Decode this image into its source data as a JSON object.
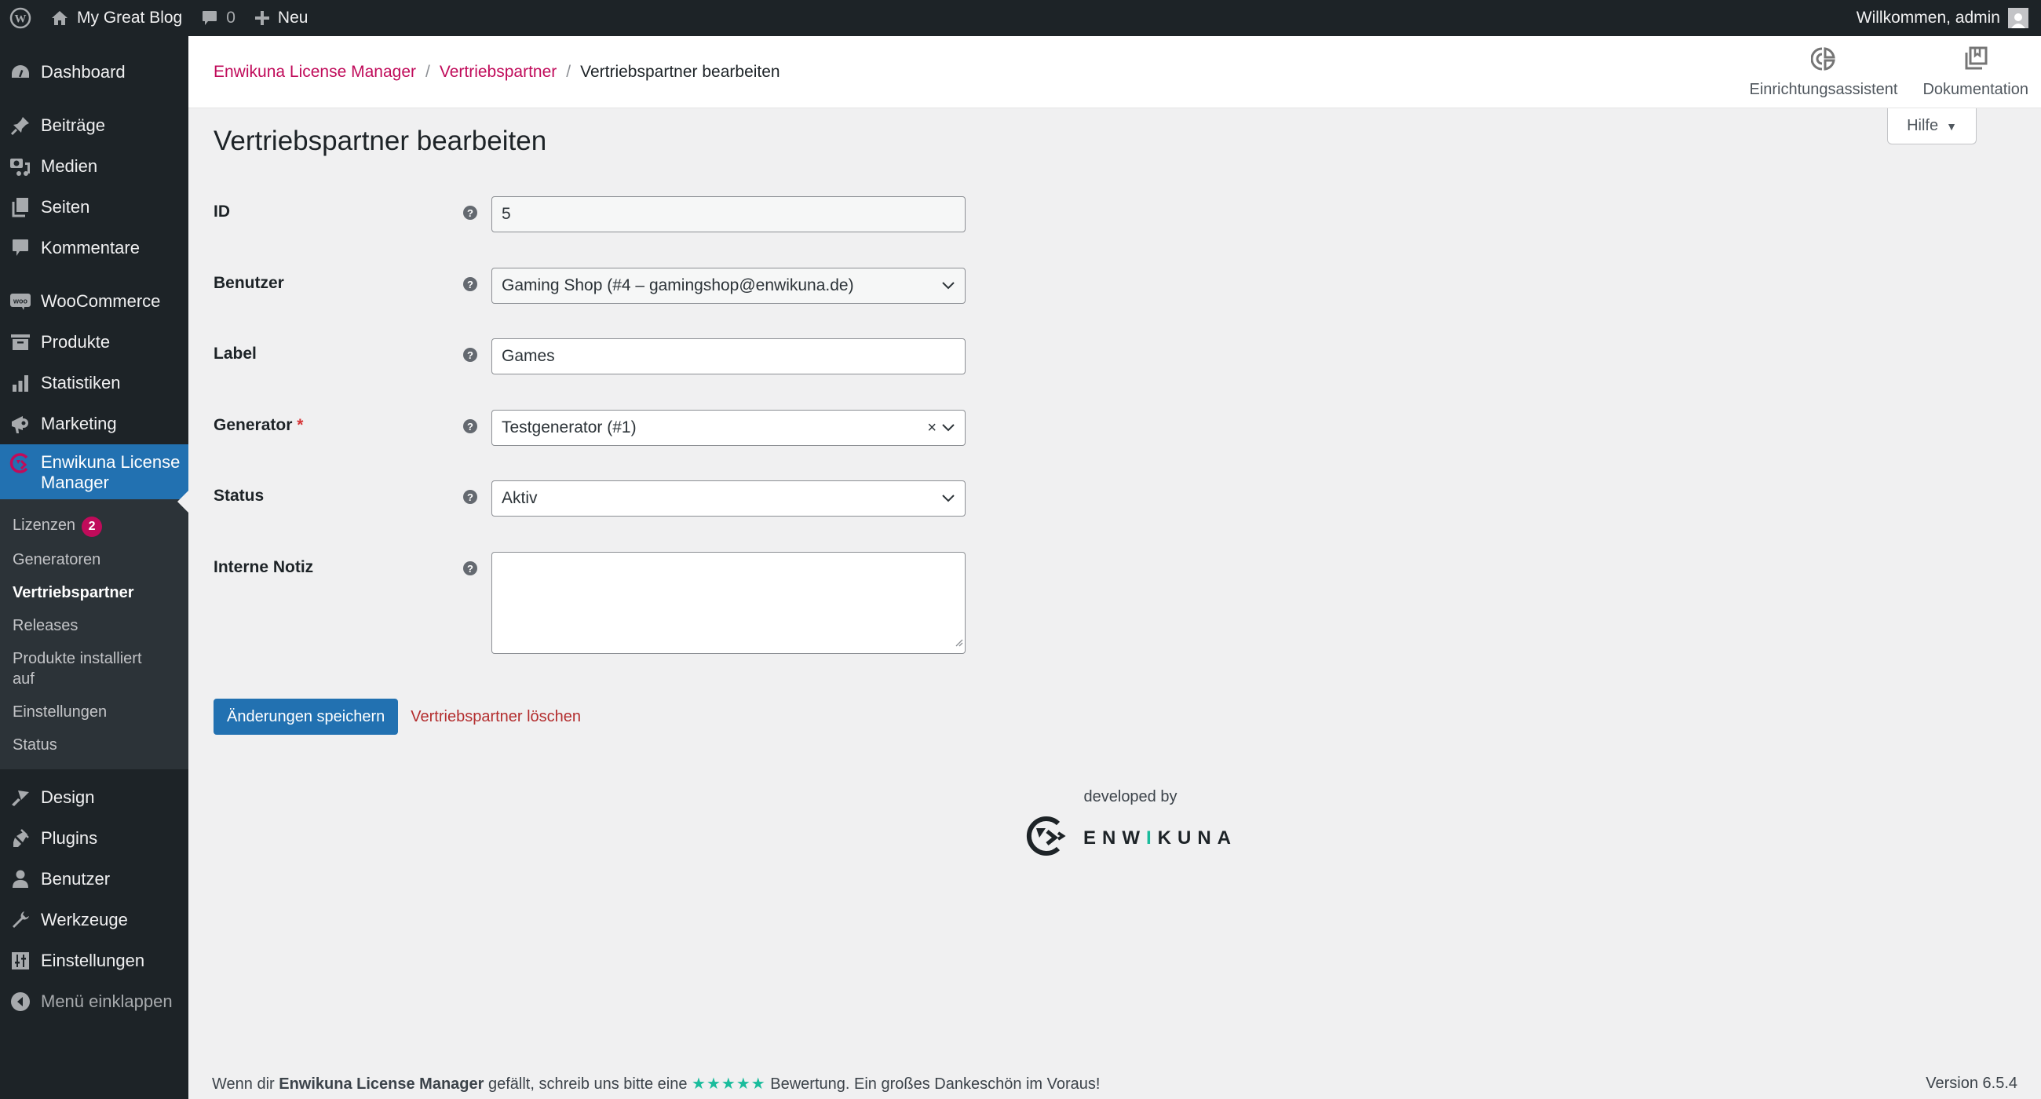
{
  "adminbar": {
    "site_name": "My Great Blog",
    "comments_count": "0",
    "new_label": "Neu",
    "greeting": "Willkommen, admin"
  },
  "sidebar": {
    "items": [
      {
        "label": "Dashboard",
        "icon": "dashboard-icon"
      },
      {
        "label": "Beiträge",
        "icon": "pin-icon"
      },
      {
        "label": "Medien",
        "icon": "media-icon"
      },
      {
        "label": "Seiten",
        "icon": "pages-icon"
      },
      {
        "label": "Kommentare",
        "icon": "comment-icon"
      },
      {
        "label": "WooCommerce",
        "icon": "woo-icon"
      },
      {
        "label": "Produkte",
        "icon": "archive-icon"
      },
      {
        "label": "Statistiken",
        "icon": "bar-chart-icon"
      },
      {
        "label": "Marketing",
        "icon": "megaphone-icon"
      },
      {
        "label": "Enwikuna License Manager",
        "icon": "enwikuna-icon"
      },
      {
        "label": "Design",
        "icon": "brush-icon"
      },
      {
        "label": "Plugins",
        "icon": "plug-icon"
      },
      {
        "label": "Benutzer",
        "icon": "user-icon"
      },
      {
        "label": "Werkzeuge",
        "icon": "wrench-icon"
      },
      {
        "label": "Einstellungen",
        "icon": "settings-icon"
      }
    ],
    "submenu": [
      {
        "label": "Lizenzen",
        "badge": "2"
      },
      {
        "label": "Generatoren"
      },
      {
        "label": "Vertriebspartner",
        "active": true
      },
      {
        "label": "Releases"
      },
      {
        "label": "Produkte installiert auf"
      },
      {
        "label": "Einstellungen"
      },
      {
        "label": "Status"
      }
    ],
    "collapse_label": "Menü einklappen"
  },
  "header": {
    "breadcrumb": [
      "Enwikuna License Manager",
      "Vertriebspartner",
      "Vertriebspartner bearbeiten"
    ],
    "actions": [
      {
        "label": "Einrichtungsassistent",
        "icon": "setup-wizard-icon"
      },
      {
        "label": "Dokumentation",
        "icon": "documentation-icon"
      }
    ],
    "help_label": "Hilfe"
  },
  "page": {
    "title": "Vertriebspartner bearbeiten",
    "fields": {
      "id": {
        "label": "ID",
        "value": "5"
      },
      "user": {
        "label": "Benutzer",
        "value": "Gaming Shop (#4 – gamingshop@enwikuna.de)"
      },
      "label": {
        "label": "Label",
        "value": "Games"
      },
      "generator": {
        "label": "Generator",
        "required_mark": "*",
        "value": "Testgenerator (#1)"
      },
      "status": {
        "label": "Status",
        "value": "Aktiv"
      },
      "note": {
        "label": "Interne Notiz",
        "value": ""
      }
    },
    "save_label": "Änderungen speichern",
    "delete_label": "Vertriebspartner löschen",
    "developed_by": "developed by",
    "logo_text_a": "ENW",
    "logo_text_b": "I",
    "logo_text_c": "KUNA"
  },
  "footer": {
    "text_before": "Wenn dir ",
    "plugin_name": "Enwikuna License Manager",
    "text_middle": " gefällt, schreib uns bitte eine ",
    "stars": "★★★★★",
    "text_after": " Bewertung. Ein großes Dankeschön im Voraus!",
    "version": "Version 6.5.4"
  },
  "colors": {
    "accent": "#c00b5a",
    "primary": "#2271b1",
    "sidebar": "#1d2327",
    "teal": "#1abc9c"
  }
}
